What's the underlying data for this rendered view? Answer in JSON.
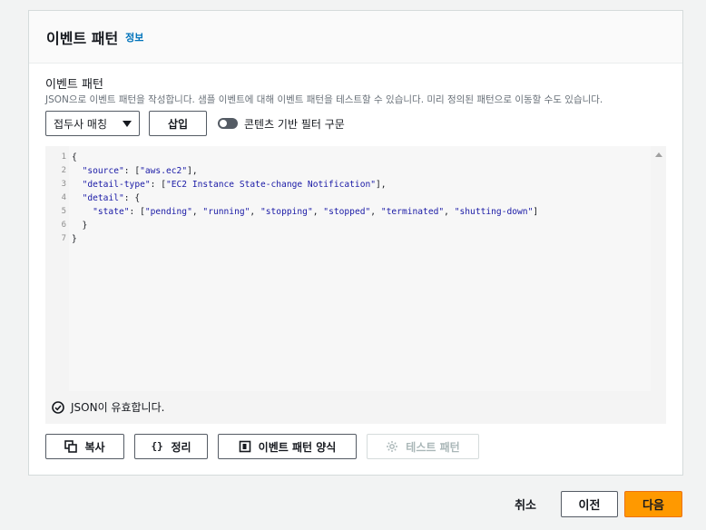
{
  "panel": {
    "title": "이벤트 패턴",
    "info_link": "정보"
  },
  "field": {
    "label": "이벤트 패턴",
    "description": "JSON으로 이벤트 패턴을 작성합니다. 샘플 이벤트에 대해 이벤트 패턴을 테스트할 수 있습니다. 미리 정의된 패턴으로 이동할 수도 있습니다."
  },
  "toolbar": {
    "select_value": "접두사 매칭",
    "insert_label": "삽입",
    "toggle_label": "콘텐츠 기반 필터 구문",
    "toggle_on": false
  },
  "editor": {
    "line_numbers": [
      "1",
      "2",
      "3",
      "4",
      "5",
      "6",
      "7"
    ],
    "lines": [
      "{",
      "  \"source\": [\"aws.ec2\"],",
      "  \"detail-type\": [\"EC2 Instance State-change Notification\"],",
      "  \"detail\": {",
      "    \"state\": [\"pending\", \"running\", \"stopping\", \"stopped\", \"terminated\", \"shutting-down\"]",
      "  }",
      "}"
    ],
    "validity_text": "JSON이 유효합니다."
  },
  "actions": {
    "copy_label": "복사",
    "format_label": "정리",
    "template_label": "이벤트 패턴 양식",
    "test_label": "테스트 패턴"
  },
  "footer": {
    "cancel_label": "취소",
    "prev_label": "이전",
    "next_label": "다음"
  },
  "colors": {
    "accent": "#ff9900",
    "link": "#0073bb",
    "disabled": "#aab7b8"
  },
  "icons": {
    "validity": "check-circle-icon",
    "copy": "copy-icon",
    "format": "braces-icon",
    "template": "template-icon",
    "test": "gear-icon"
  }
}
